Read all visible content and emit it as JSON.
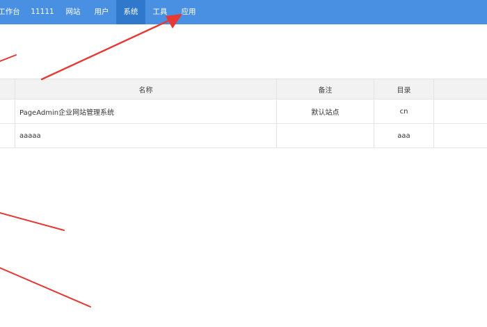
{
  "nav": {
    "items": [
      {
        "label": "工作台"
      },
      {
        "label": "11111"
      },
      {
        "label": "网站"
      },
      {
        "label": "用户"
      },
      {
        "label": "系统",
        "active": true
      },
      {
        "label": "工具"
      },
      {
        "label": "应用"
      }
    ]
  },
  "table": {
    "headers": [
      "",
      "名称",
      "备注",
      "目录",
      ""
    ],
    "rows": [
      {
        "name": "PageAdmin企业网站管理系统",
        "note": "默认站点",
        "dir": "cn"
      },
      {
        "name": "aaaaa",
        "note": "",
        "dir": "aaa"
      }
    ]
  },
  "colors": {
    "nav_bg": "#4a90e2",
    "nav_active": "#2f78cc",
    "arrow": "#e53935"
  }
}
